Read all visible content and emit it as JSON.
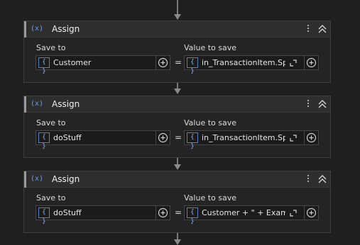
{
  "activities": [
    {
      "title": "Assign",
      "save_to_label": "Save to",
      "save_to_value": "Customer",
      "value_label": "Value to save",
      "value_text": "in_TransactionItem.Sp",
      "equals": "="
    },
    {
      "title": "Assign",
      "save_to_label": "Save to",
      "save_to_value": "doStuff",
      "value_label": "Value to save",
      "value_text": "in_TransactionItem.Sp",
      "equals": "="
    },
    {
      "title": "Assign",
      "save_to_label": "Save to",
      "save_to_value": "doStuff",
      "value_label": "Value to save",
      "value_text": "Customer + \" + Examp",
      "equals": "="
    }
  ],
  "icons": {
    "activity": "assign-variable-icon",
    "field": "expression-braces-icon"
  },
  "glyphs": {
    "activity_icon": "(x)",
    "braces": "{ }"
  },
  "colors": {
    "background": "#1f1f1f",
    "accent_blue": "#6d9bea"
  }
}
